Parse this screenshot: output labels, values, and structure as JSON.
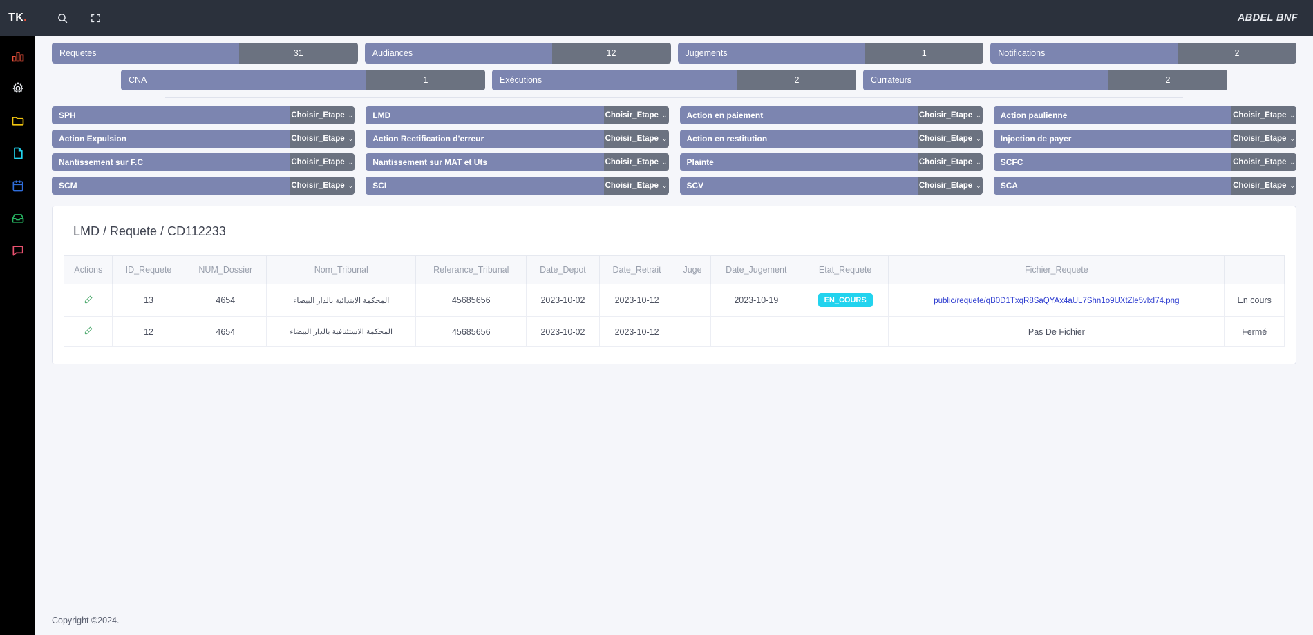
{
  "brand": {
    "text": "TK",
    "dot": "."
  },
  "topbar": {
    "search_icon": "search-icon",
    "fullscreen_icon": "fullscreen-icon",
    "user": "ABDEL BNF"
  },
  "sidebar": {
    "items": [
      {
        "name": "chart-icon",
        "color": "#e8503a"
      },
      {
        "name": "gear-icon",
        "color": "#e9ecf1"
      },
      {
        "name": "folder-icon",
        "color": "#f1c40f"
      },
      {
        "name": "document-icon",
        "color": "#22d3ee"
      },
      {
        "name": "calendar-icon",
        "color": "#2f6ddb"
      },
      {
        "name": "inbox-icon",
        "color": "#26b562"
      },
      {
        "name": "chat-icon",
        "color": "#e8516f"
      }
    ]
  },
  "stats": {
    "row1": [
      {
        "label": "Requetes",
        "value": "31"
      },
      {
        "label": "Audiances",
        "value": "12"
      },
      {
        "label": "Jugements",
        "value": "1"
      },
      {
        "label": "Notifications",
        "value": "2"
      }
    ],
    "row2": [
      {
        "label": "CNA",
        "value": "1"
      },
      {
        "label": "Exécutions",
        "value": "2"
      },
      {
        "label": "Currateurs",
        "value": "2"
      }
    ]
  },
  "etape": {
    "select_label": "Choisir_Etape",
    "chevron": "⌄",
    "items": [
      {
        "label": "SPH"
      },
      {
        "label": "LMD"
      },
      {
        "label": "Action en paiement"
      },
      {
        "label": "Action paulienne"
      },
      {
        "label": "Action Expulsion"
      },
      {
        "label": "Action Rectification d'erreur"
      },
      {
        "label": "Action en restitution"
      },
      {
        "label": "Injoction de payer"
      },
      {
        "label": "Nantissement sur F.C"
      },
      {
        "label": "Nantissement sur MAT et Uts"
      },
      {
        "label": "Plainte"
      },
      {
        "label": "SCFC"
      },
      {
        "label": "SCM"
      },
      {
        "label": "SCI"
      },
      {
        "label": "SCV"
      },
      {
        "label": "SCA"
      }
    ]
  },
  "panel": {
    "title": "LMD / Requete / CD112233",
    "columns": [
      "Actions",
      "ID_Requete",
      "NUM_Dossier",
      "Nom_Tribunal",
      "Referance_Tribunal",
      "Date_Depot",
      "Date_Retrait",
      "Juge",
      "Date_Jugement",
      "Etat_Requete",
      "Fichier_Requete",
      ""
    ],
    "rows": [
      {
        "action_icon": "edit-pencil-icon",
        "id_requete": "13",
        "num_dossier": "4654",
        "nom_tribunal": "المحكمة الابتدائية بالدار البيضاء",
        "referance_tribunal": "45685656",
        "date_depot": "2023-10-02",
        "date_retrait": "2023-10-12",
        "juge": "",
        "date_jugement": "2023-10-19",
        "etat_requete": "EN_COURS",
        "fichier_requete": "public/requete/qB0D1TxqR8SaQYAx4aUL7Shn1o9UXtZle5vlxI74.png",
        "fichier_is_link": true,
        "statut": "En cours"
      },
      {
        "action_icon": "edit-pencil-icon",
        "id_requete": "12",
        "num_dossier": "4654",
        "nom_tribunal": "المحكمة الاستئنافية بالدار البيضاء",
        "referance_tribunal": "45685656",
        "date_depot": "2023-10-02",
        "date_retrait": "2023-10-12",
        "juge": "",
        "date_jugement": "",
        "etat_requete": "",
        "fichier_requete": "Pas De Fichier",
        "fichier_is_link": false,
        "statut": "Fermé"
      }
    ]
  },
  "footer": {
    "copyright": "Copyright ©2024."
  },
  "colors": {
    "label_purple": "#7c85b0",
    "value_gray": "#6b7280",
    "badge_cyan": "#22d3ee",
    "link_blue": "#2f3ed0",
    "topbar_dark": "#2b313c",
    "page_bg": "#f5f6fa"
  }
}
